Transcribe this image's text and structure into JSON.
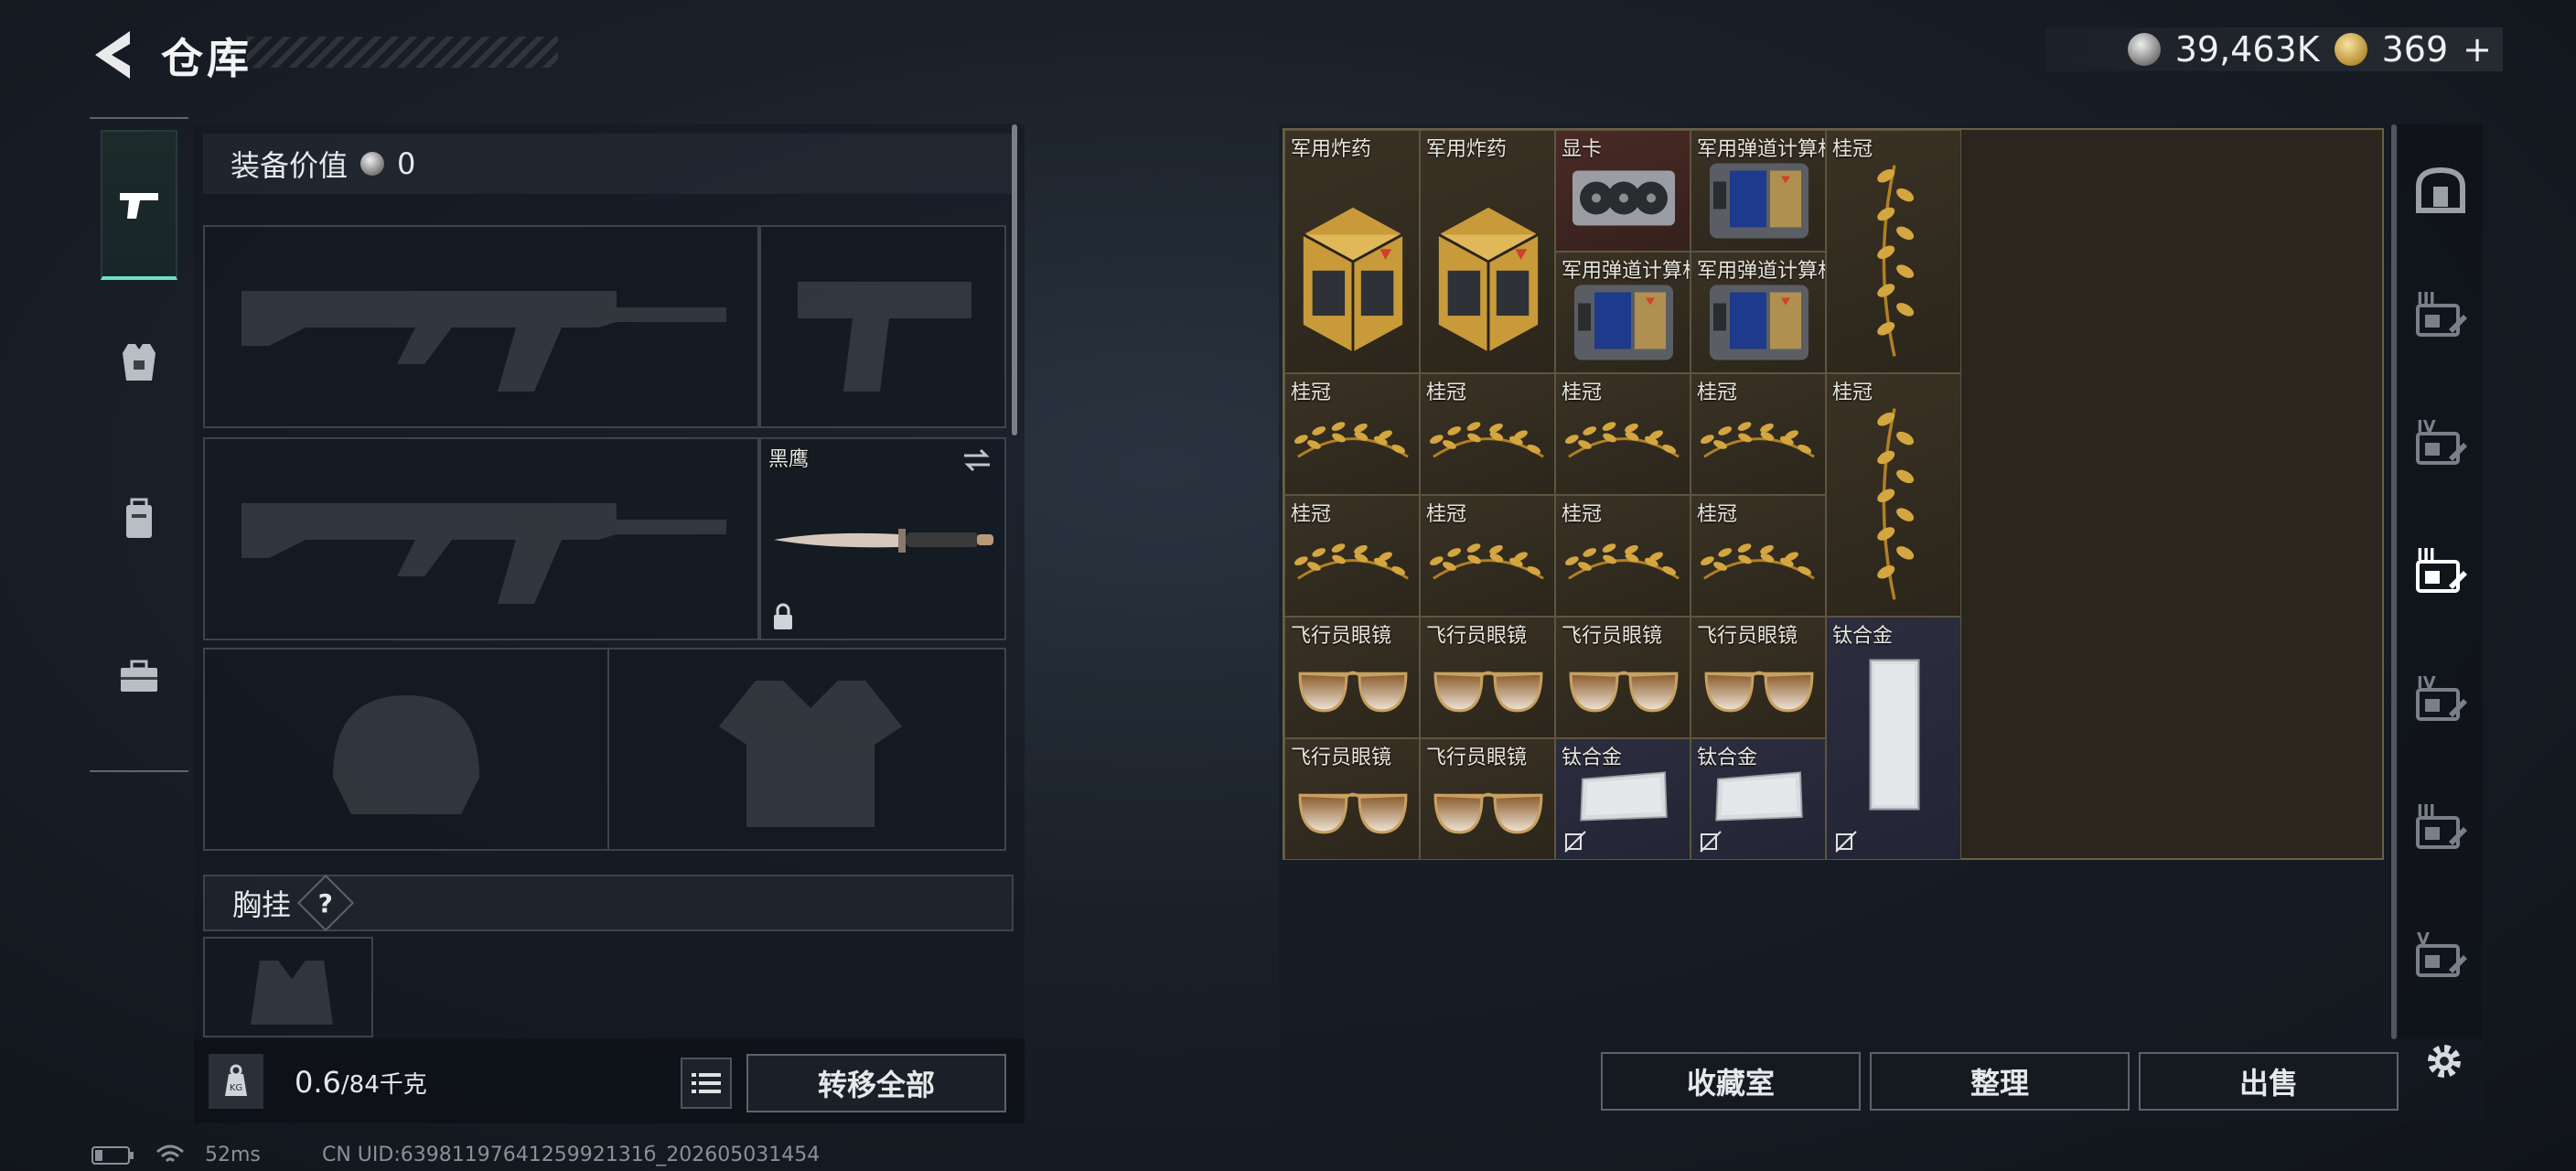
{
  "header": {
    "title": "仓库",
    "silver_amount": "39,463K",
    "gold_amount": "369",
    "gold_plus": "+"
  },
  "equipment": {
    "value_label": "装备价值",
    "value": "0",
    "knife_name": "黑鹰",
    "chest_label": "胸挂",
    "chest_help": "?"
  },
  "footer": {
    "weight_current": "0.6",
    "weight_max": "/84千克",
    "weight_badge": "KG",
    "transfer_all": "转移全部"
  },
  "inventory": {
    "items": [
      {
        "label": "军用炸药",
        "kind": "explosive"
      },
      {
        "label": "军用炸药",
        "kind": "explosive"
      },
      {
        "label": "显卡",
        "kind": "gpu"
      },
      {
        "label": "军用弹道计算机",
        "kind": "computer"
      },
      {
        "label": "桂冠",
        "kind": "laurel-tall"
      },
      {
        "label": "军用弹道计算机",
        "kind": "computer"
      },
      {
        "label": "军用弹道计算机",
        "kind": "computer"
      },
      {
        "label": "桂冠",
        "kind": "laurel"
      },
      {
        "label": "桂冠",
        "kind": "laurel"
      },
      {
        "label": "桂冠",
        "kind": "laurel"
      },
      {
        "label": "桂冠",
        "kind": "laurel"
      },
      {
        "label": "桂冠",
        "kind": "laurel-tall"
      },
      {
        "label": "桂冠",
        "kind": "laurel"
      },
      {
        "label": "桂冠",
        "kind": "laurel"
      },
      {
        "label": "桂冠",
        "kind": "laurel"
      },
      {
        "label": "桂冠",
        "kind": "laurel"
      },
      {
        "label": "飞行员眼镜",
        "kind": "glasses"
      },
      {
        "label": "飞行员眼镜",
        "kind": "glasses"
      },
      {
        "label": "飞行员眼镜",
        "kind": "glasses"
      },
      {
        "label": "飞行员眼镜",
        "kind": "glasses"
      },
      {
        "label": "钛合金",
        "kind": "titanium-tall"
      },
      {
        "label": "飞行员眼镜",
        "kind": "glasses"
      },
      {
        "label": "飞行员眼镜",
        "kind": "glasses"
      },
      {
        "label": "钛合金",
        "kind": "titanium"
      },
      {
        "label": "钛合金",
        "kind": "titanium"
      }
    ],
    "buttons": {
      "collection": "收藏室",
      "sort": "整理",
      "sell": "出售"
    },
    "category_tiers": [
      "",
      "III",
      "IV",
      "III",
      "IV",
      "III",
      "V"
    ]
  },
  "status": {
    "ping": "52ms",
    "uid": "CN UID:6398119764125992131б_202605031454"
  },
  "colors": {
    "accent": "#6de0c0",
    "gold_item_bg": "#3a3224",
    "red_item_bg": "#4a2a26",
    "blue_item_bg": "#2c2e40"
  }
}
